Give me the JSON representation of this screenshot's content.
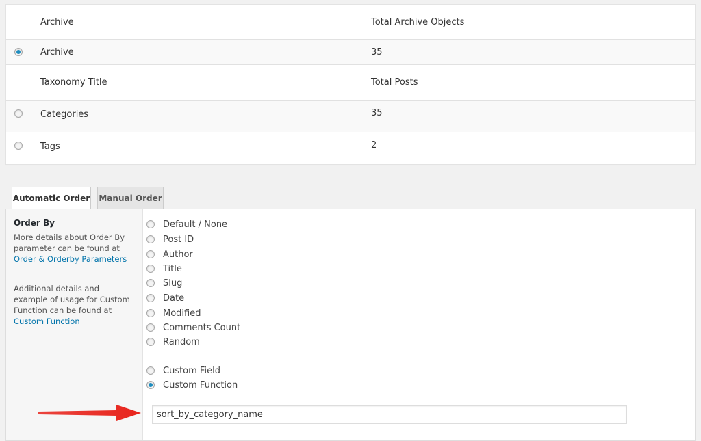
{
  "archive_table": {
    "head1": {
      "col1": "Archive",
      "col2": "Total Archive Objects"
    },
    "archive_row": {
      "name": "Archive",
      "value": "35",
      "checked": true
    },
    "head2": {
      "col1": "Taxonomy Title",
      "col2": "Total Posts"
    },
    "taxonomy_rows": [
      {
        "name": "Categories",
        "value": "35",
        "checked": false
      },
      {
        "name": "Tags",
        "value": "2",
        "checked": false
      }
    ]
  },
  "tabs": [
    {
      "label": "Automatic Order",
      "active": true
    },
    {
      "label": "Manual Order",
      "active": false
    }
  ],
  "sidebar": {
    "title": "Order By",
    "para1_text": "More details about Order By parameter can be found at",
    "para1_link": "Order & Orderby Parameters",
    "para2_text": "Additional details and example of usage for Custom Function can be found at",
    "para2_link": "Custom Function"
  },
  "order_options": [
    {
      "label": "Default / None",
      "checked": false
    },
    {
      "label": "Post ID",
      "checked": false
    },
    {
      "label": "Author",
      "checked": false
    },
    {
      "label": "Title",
      "checked": false
    },
    {
      "label": "Slug",
      "checked": false
    },
    {
      "label": "Date",
      "checked": false
    },
    {
      "label": "Modified",
      "checked": false
    },
    {
      "label": "Comments Count",
      "checked": false
    },
    {
      "label": "Random",
      "checked": false
    }
  ],
  "custom_options": [
    {
      "label": "Custom Field",
      "checked": false
    },
    {
      "label": "Custom Function",
      "checked": true
    }
  ],
  "custom_function_input": {
    "value": "sort_by_category_name"
  },
  "colors": {
    "accent": "#0073aa",
    "radio_checked": "#1e8cbe",
    "arrow": "#e8241c"
  },
  "annotation": {
    "icon": "red-arrow-icon"
  }
}
